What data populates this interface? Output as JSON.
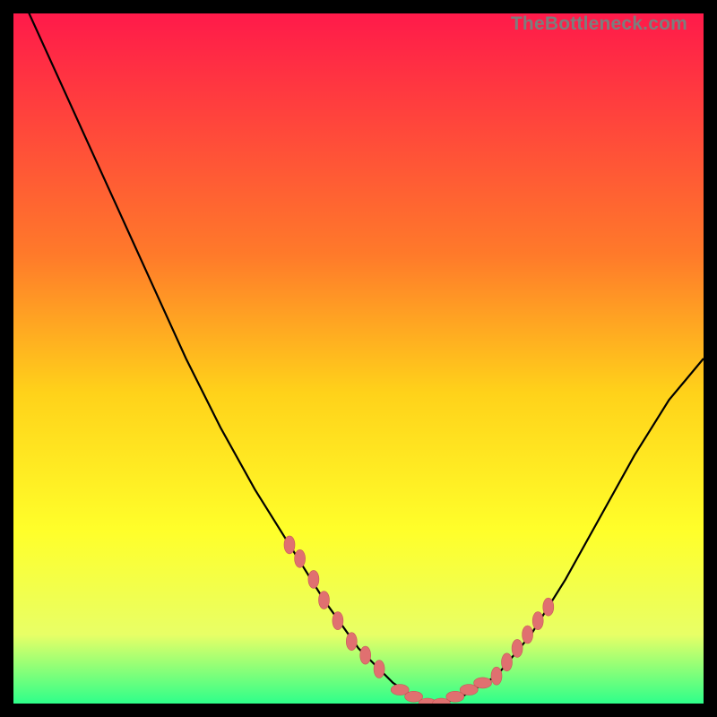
{
  "watermark": "TheBottleneck.com",
  "colors": {
    "gradient_top": "#ff1a4a",
    "gradient_mid1": "#ff7a2a",
    "gradient_mid2": "#ffd21a",
    "gradient_mid3": "#ffff2a",
    "gradient_mid4": "#e8ff66",
    "gradient_bottom": "#2eff8a",
    "curve": "#000000",
    "marker_fill": "#e07070",
    "marker_stroke": "#c85858"
  },
  "chart_data": {
    "type": "line",
    "title": "",
    "xlabel": "",
    "ylabel": "",
    "xlim": [
      0,
      100
    ],
    "ylim": [
      0,
      100
    ],
    "series": [
      {
        "name": "bottleneck_curve",
        "x": [
          0,
          5,
          10,
          15,
          20,
          25,
          30,
          35,
          40,
          45,
          50,
          55,
          58,
          60,
          62,
          65,
          70,
          75,
          80,
          85,
          90,
          95,
          100
        ],
        "y": [
          105,
          94,
          83,
          72,
          61,
          50,
          40,
          31,
          23,
          15,
          8,
          3,
          1,
          0,
          0,
          1,
          4,
          10,
          18,
          27,
          36,
          44,
          50
        ]
      }
    ],
    "markers_left": {
      "x": [
        40,
        41.5,
        43.5,
        45,
        47,
        49,
        51,
        53
      ],
      "y": [
        23,
        21,
        18,
        15,
        12,
        9,
        7,
        5
      ]
    },
    "markers_bottom": {
      "x": [
        56,
        58,
        60,
        62,
        64,
        66,
        68
      ],
      "y": [
        2,
        1,
        0,
        0,
        1,
        2,
        3
      ]
    },
    "markers_right": {
      "x": [
        70,
        71.5,
        73,
        74.5,
        76,
        77.5
      ],
      "y": [
        4,
        6,
        8,
        10,
        12,
        14
      ]
    }
  }
}
